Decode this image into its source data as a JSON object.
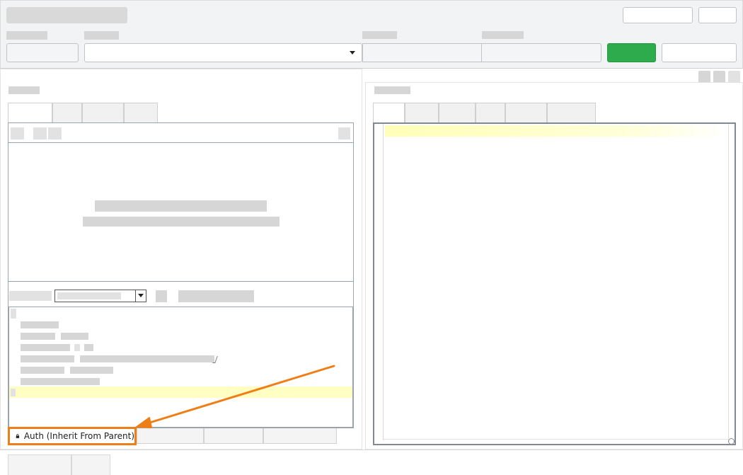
{
  "auth_indicator": {
    "label": "Auth (Inherit From Parent)",
    "icon": "lock-icon"
  },
  "annotation": {
    "arrow_color": "#f07e16",
    "box_color": "#f07e16"
  },
  "colors": {
    "send_button": "#2eab4c",
    "highlight_line": "#ffffc4"
  }
}
